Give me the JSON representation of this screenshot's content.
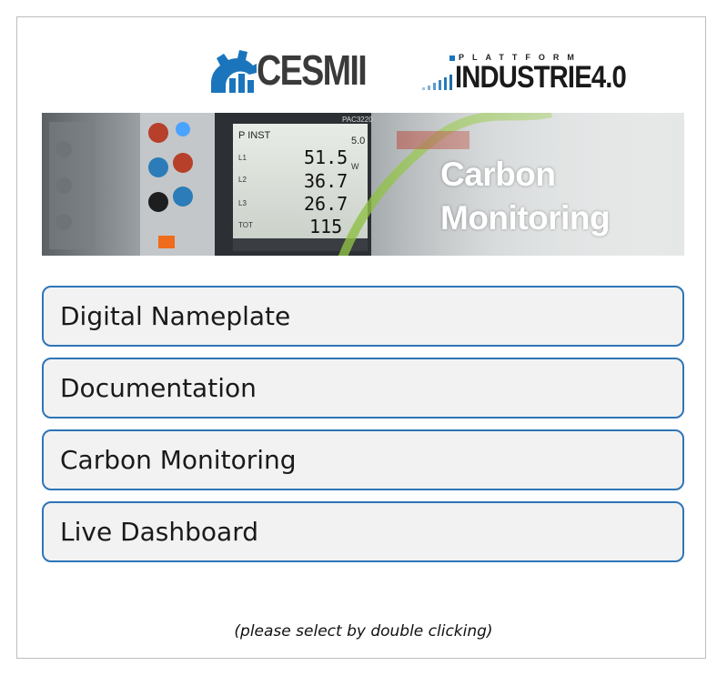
{
  "logos": {
    "cesmii": "CESMII",
    "industrie_top": "PLATTFORM",
    "industrie_main": "INDUSTRIE4.0"
  },
  "banner": {
    "title_line1": "Carbon",
    "title_line2": "Monitoring",
    "meter": {
      "header": "P INST",
      "header_right": "5.0",
      "model": "PAC3220",
      "rows": [
        {
          "label": "L1",
          "value": "51.5"
        },
        {
          "label": "L2",
          "value": "36.7"
        },
        {
          "label": "L3",
          "value": "26.7"
        },
        {
          "label": "TOT",
          "value": "115"
        }
      ],
      "unit": "W"
    }
  },
  "menu": {
    "items": [
      {
        "label": "Digital Nameplate"
      },
      {
        "label": "Documentation"
      },
      {
        "label": "Carbon Monitoring"
      },
      {
        "label": "Live Dashboard"
      }
    ]
  },
  "hint": "(please select by double clicking)",
  "colors": {
    "accent_border": "#2e75b6",
    "button_bg": "#f2f2f2",
    "cesmii_blue": "#1b75bc"
  }
}
